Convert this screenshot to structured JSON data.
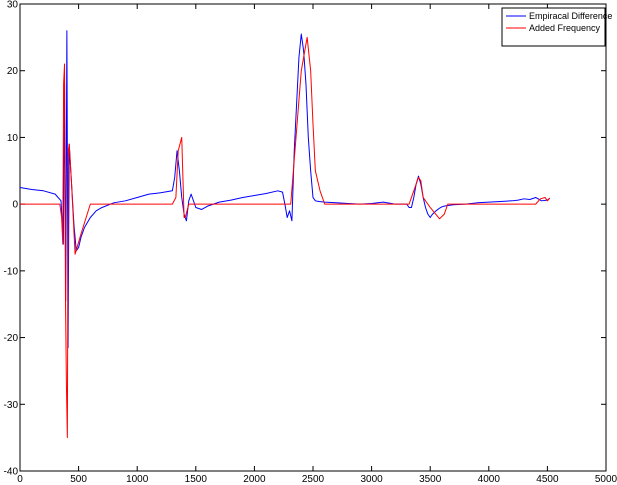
{
  "chart_data": {
    "type": "line",
    "title": "",
    "xlabel": "",
    "ylabel": "",
    "xlim": [
      0,
      5000
    ],
    "ylim": [
      -40,
      30
    ],
    "xticks": [
      0,
      500,
      1000,
      1500,
      2000,
      2500,
      3000,
      3500,
      4000,
      4500,
      5000
    ],
    "xtick_labels": [
      "0",
      "500",
      "1000",
      "1500",
      "2000",
      "2500",
      "3000",
      "3500",
      "4000",
      "4500",
      "5000"
    ],
    "yticks": [
      -40,
      -30,
      -20,
      -10,
      0,
      10,
      20,
      30
    ],
    "ytick_labels": [
      "-40",
      "-30",
      "-20",
      "-10",
      "0",
      "10",
      "20",
      "30"
    ],
    "grid": false,
    "legend": {
      "position": "top-right",
      "entries": [
        "Empiracal Difference",
        "Added Frequency"
      ]
    },
    "series": [
      {
        "name": "Empiracal Difference",
        "color": "#0000ff",
        "x": [
          0,
          100,
          200,
          300,
          350,
          370,
          380,
          390,
          400,
          410,
          420,
          440,
          460,
          480,
          500,
          520,
          550,
          600,
          650,
          700,
          800,
          900,
          1000,
          1100,
          1150,
          1200,
          1300,
          1320,
          1340,
          1360,
          1380,
          1400,
          1420,
          1440,
          1460,
          1500,
          1550,
          1600,
          1700,
          1800,
          1900,
          2000,
          2100,
          2200,
          2240,
          2260,
          2280,
          2300,
          2320,
          2340,
          2360,
          2380,
          2400,
          2420,
          2440,
          2460,
          2480,
          2500,
          2520,
          2550,
          2600,
          2700,
          2800,
          2900,
          3000,
          3100,
          3200,
          3300,
          3320,
          3340,
          3360,
          3380,
          3400,
          3420,
          3440,
          3460,
          3480,
          3500,
          3520,
          3550,
          3580,
          3600,
          3620,
          3650,
          3700,
          3800,
          3900,
          4000,
          4100,
          4200,
          4250,
          4300,
          4350,
          4400,
          4450,
          4500,
          4520
        ],
        "y": [
          2.5,
          2.2,
          2.0,
          1.5,
          0.5,
          -6.0,
          18.0,
          -14.5,
          26.0,
          -21.5,
          9.0,
          3.0,
          -3.0,
          -7.0,
          -6.5,
          -5.0,
          -3.5,
          -2.0,
          -1.0,
          -0.5,
          0.2,
          0.5,
          1.0,
          1.5,
          1.6,
          1.7,
          2.0,
          4.0,
          8.0,
          5.0,
          1.0,
          -1.5,
          -2.5,
          0.5,
          1.5,
          -0.5,
          -0.8,
          -0.3,
          0.3,
          0.6,
          1.0,
          1.3,
          1.6,
          2.0,
          1.8,
          0.0,
          -2.0,
          -1.0,
          -2.5,
          8.0,
          15.0,
          22.0,
          25.5,
          23.0,
          18.0,
          10.0,
          5.0,
          1.0,
          0.5,
          0.4,
          0.3,
          0.2,
          0.1,
          0.0,
          0.1,
          0.3,
          0.0,
          0.0,
          -0.5,
          -0.5,
          1.0,
          3.0,
          4.2,
          3.0,
          1.0,
          -0.5,
          -1.5,
          -2.0,
          -1.5,
          -1.0,
          -0.6,
          -0.4,
          -0.3,
          -0.2,
          -0.1,
          0.0,
          0.2,
          0.3,
          0.4,
          0.5,
          0.6,
          0.8,
          0.7,
          1.0,
          0.5,
          0.6,
          0.9
        ]
      },
      {
        "name": "Added Frequency",
        "color": "#ff0000",
        "x": [
          0,
          340,
          355,
          365,
          372,
          380,
          388,
          396,
          404,
          412,
          420,
          440,
          470,
          520,
          600,
          800,
          1000,
          1200,
          1300,
          1330,
          1350,
          1380,
          1400,
          1410,
          1440,
          1460,
          1500,
          1800,
          2000,
          2200,
          2310,
          2400,
          2450,
          2480,
          2500,
          2520,
          2560,
          2600,
          2800,
          3000,
          3200,
          3320,
          3340,
          3360,
          3400,
          3420,
          3440,
          3500,
          3580,
          3620,
          3650,
          3700,
          3900,
          4100,
          4300,
          4400,
          4440,
          4480,
          4500,
          4520
        ],
        "y": [
          0,
          0,
          -2.0,
          -6.0,
          18.0,
          21.0,
          -14.0,
          -27.0,
          -35.0,
          8.0,
          9.0,
          3.0,
          -7.5,
          -4.5,
          0,
          0,
          0,
          0,
          0,
          1.0,
          8.0,
          10.0,
          -2.0,
          -2.0,
          0,
          0,
          0,
          0,
          0,
          0,
          0,
          20.0,
          25.0,
          20.0,
          12.0,
          5.0,
          2.0,
          0,
          0,
          0,
          0,
          0,
          1.0,
          2.0,
          4.0,
          3.5,
          1.0,
          -0.5,
          -2.2,
          -1.5,
          0,
          0,
          0,
          0,
          0,
          0,
          0.8,
          1.0,
          0.5,
          0.9
        ]
      }
    ]
  }
}
